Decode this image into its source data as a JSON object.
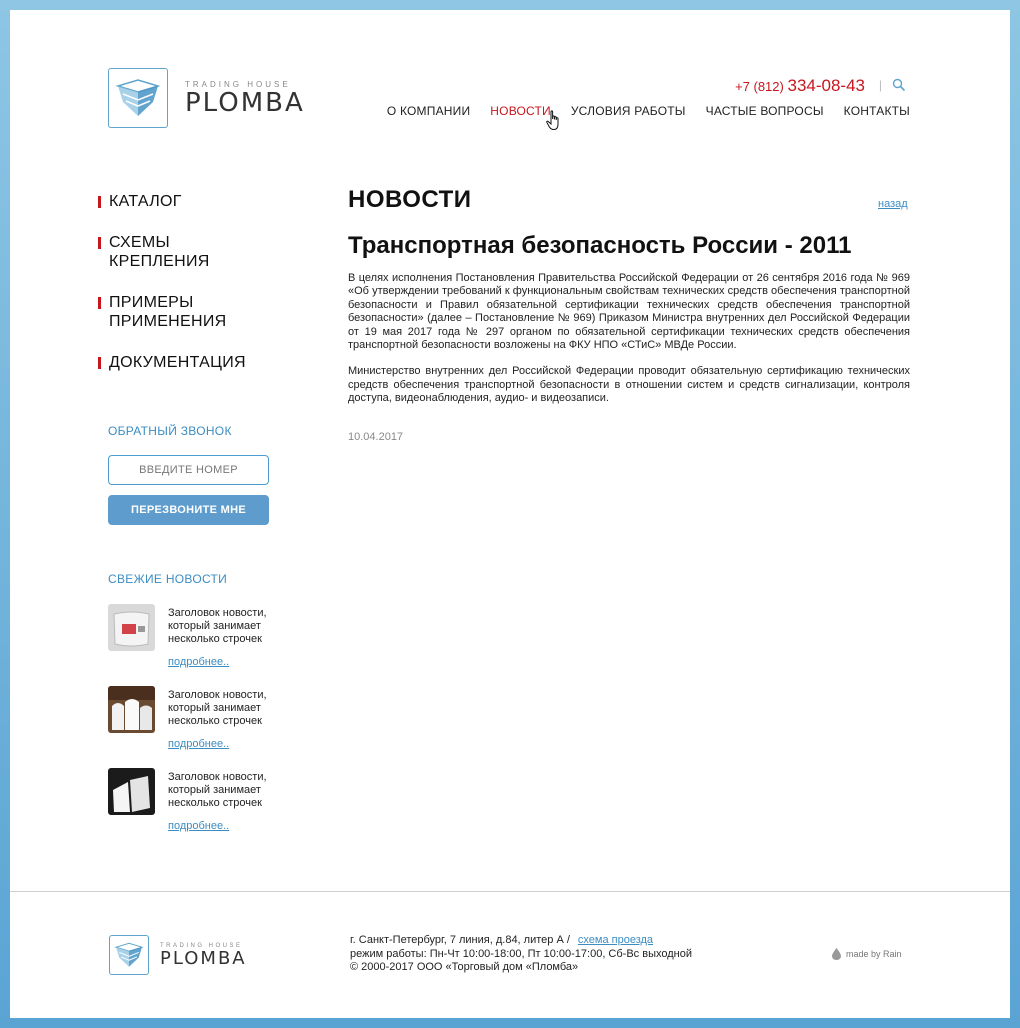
{
  "header": {
    "logo_sub": "TRADING HOUSE",
    "logo_main": "PLOMBA",
    "phone_code": "+7 (812)",
    "phone_number": "334-08-43",
    "separator": "|",
    "nav": [
      {
        "label": "О КОМПАНИИ",
        "active": false
      },
      {
        "label": "НОВОСТИ",
        "active": true
      },
      {
        "label": "УСЛОВИЯ РАБОТЫ",
        "active": false
      },
      {
        "label": "ЧАСТЫЕ ВОПРОСЫ",
        "active": false
      },
      {
        "label": "КОНТАКТЫ",
        "active": false
      }
    ]
  },
  "sidebar": {
    "menu": [
      {
        "line1": "КАТАЛОГ",
        "line2": ""
      },
      {
        "line1": "СХЕМЫ",
        "line2": "КРЕПЛЕНИЯ"
      },
      {
        "line1": "ПРИМЕРЫ",
        "line2": "ПРИМЕНЕНИЯ"
      },
      {
        "line1": "ДОКУМЕНТАЦИЯ",
        "line2": ""
      }
    ],
    "callback_title": "ОБРАТНЫЙ ЗВОНОК",
    "phone_placeholder": "ВВЕДИТЕ НОМЕР",
    "callback_button": "ПЕРЕЗВОНИТЕ МНЕ",
    "news_title": "СВЕЖИЕ НОВОСТИ",
    "news": [
      {
        "line1": "Заголовок новости,",
        "line2": "который занимает",
        "line3": "несколько строчек",
        "more": "подробнее.."
      },
      {
        "line1": "Заголовок новости,",
        "line2": "который занимает",
        "line3": "несколько строчек",
        "more": "подробнее.."
      },
      {
        "line1": "Заголовок новости,",
        "line2": "который занимает",
        "line3": "несколько строчек",
        "more": "подробнее.."
      }
    ]
  },
  "main": {
    "section_title": "НОВОСТИ",
    "back_link": "назад",
    "article_title": "Транспортная безопасность России - 2011",
    "paragraph1": "В целях исполнения Постановления Правительства Российской Федерации от 26 сентября 2016 года № 969 «Об утверждении требований к функциональным свойствам технических средств обеспечения транспортной безопасности и Правил обязательной сертификации технических средств обеспечения транспортной безопасности» (далее – Постановление № 969) Приказом Министра внутренних дел Российской Федерации от 19 мая 2017 года № 297 органом по обязательной сертификации технических средств обеспечения транспортной безопасности возложены на ФКУ НПО «СТиС» МВДе России.",
    "paragraph2": "Министерство внутренних дел Российской Федерации проводит обязательную сертификацию технических средств обеспечения транспортной безопасности в отношении систем и средств сигнализации, контроля доступа, видеонаблюдения, аудио- и видеозаписи.",
    "date": "10.04.2017"
  },
  "footer": {
    "address": "г. Санкт-Петербург, 7 линия, д.84, литер А   /",
    "map_link": "схема проезда",
    "hours": "режим работы: Пн-Чт 10:00-18:00, Пт 10:00-17:00, Сб-Вс выходной",
    "copyright": "© 2000-2017 ООО «Торговый дом «Пломба»",
    "made_by": "made by Rain"
  },
  "colors": {
    "accent_red": "#c8161d",
    "accent_blue": "#3b8dc2",
    "button_blue": "#5d9ccc"
  }
}
